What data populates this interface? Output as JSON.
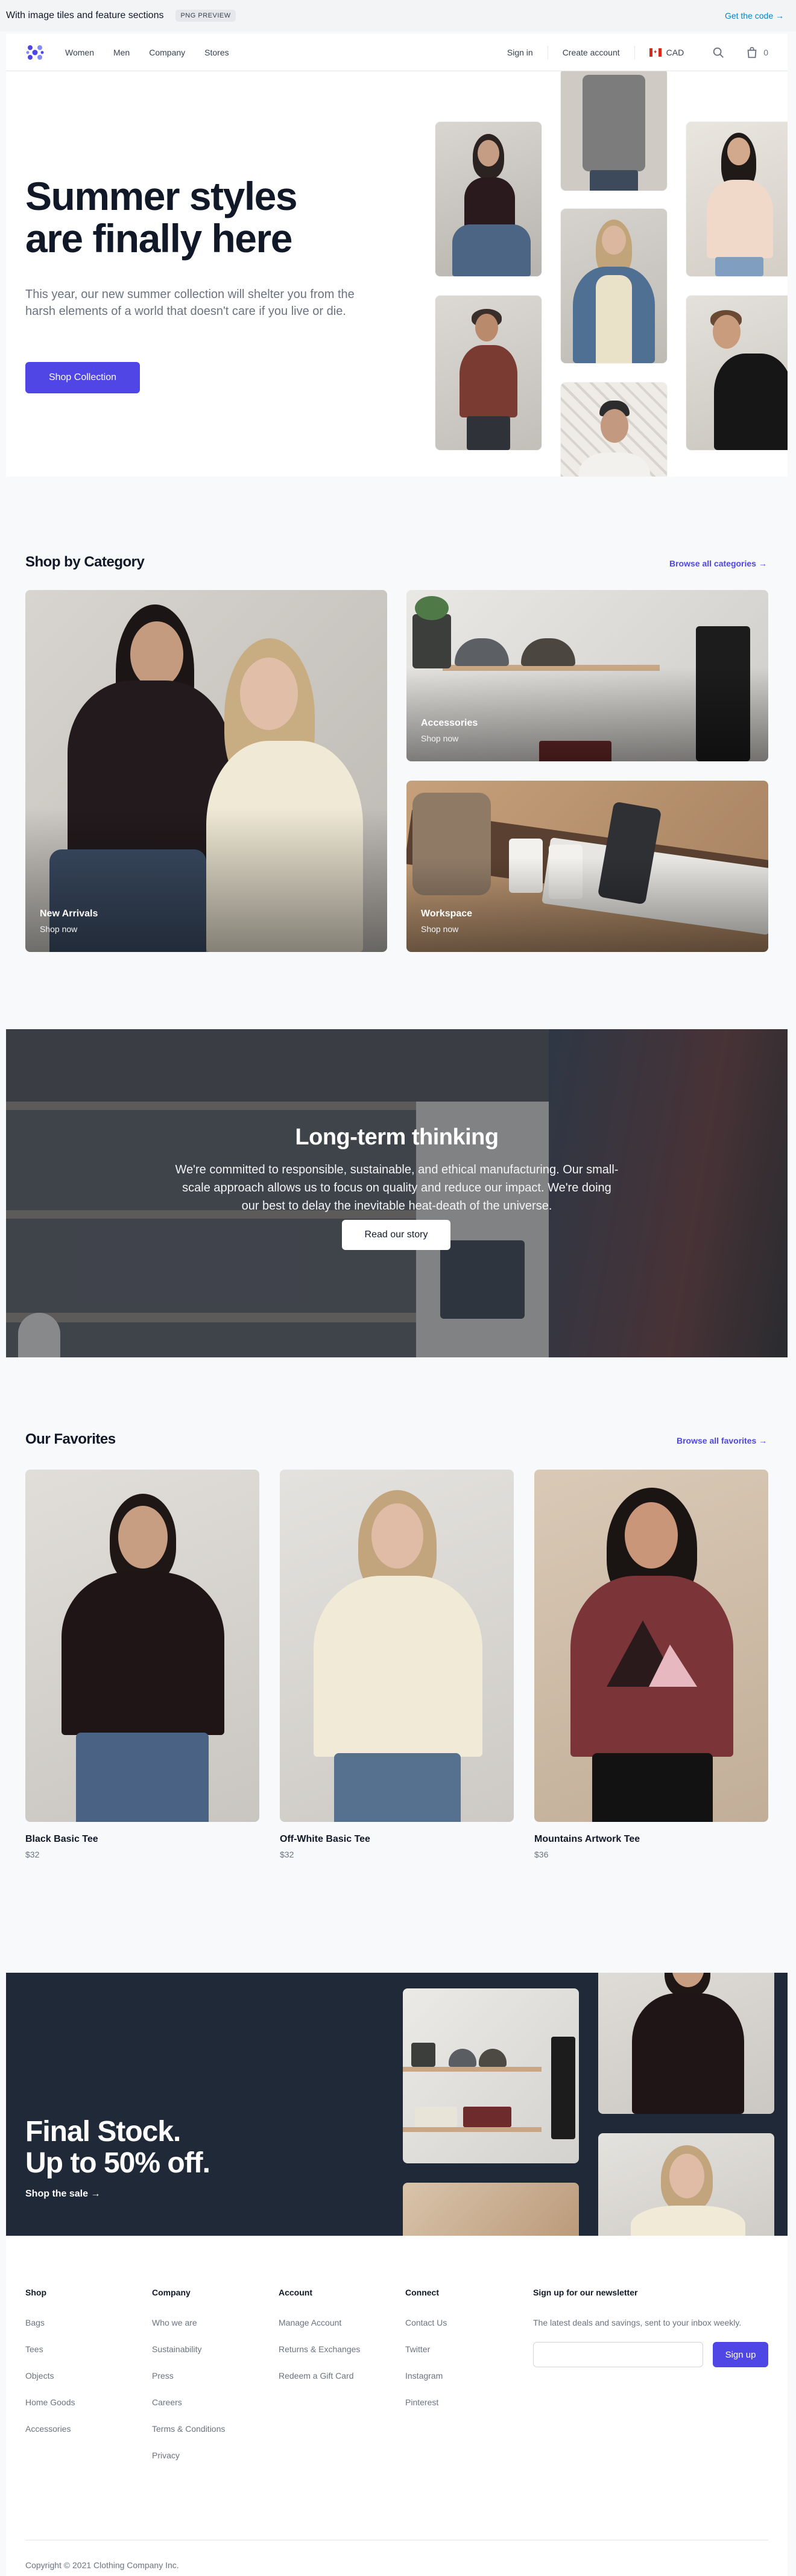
{
  "preview": {
    "title": "With image tiles and feature sections",
    "badge": "PNG PREVIEW",
    "code_link": "Get the code →"
  },
  "nav": {
    "links": [
      "Women",
      "Men",
      "Company",
      "Stores"
    ],
    "sign_in": "Sign in",
    "create_account": "Create account",
    "currency": "CAD",
    "cart_count": "0",
    "logo_icon": "logo-icon",
    "colors": {
      "brand": "#4f46e5"
    }
  },
  "hero": {
    "title": "Summer styles are finally here",
    "description": "This year, our new summer collection will shelter you from the harsh elements of a world that doesn't care if you live or die.",
    "cta": "Shop Collection"
  },
  "category": {
    "title": "Shop by Category",
    "browse_link": "Browse all categories →",
    "cards": [
      {
        "label": "New Arrivals",
        "sub": "Shop now"
      },
      {
        "label": "Accessories",
        "sub": "Shop now"
      },
      {
        "label": "Workspace",
        "sub": "Shop now"
      }
    ]
  },
  "longterm": {
    "title": "Long-term thinking",
    "description": "We're committed to responsible, sustainable, and ethical manufacturing. Our small-scale approach allows us to focus on quality and reduce our impact. We're doing our best to delay the inevitable heat-death of the universe.",
    "cta": "Read our story"
  },
  "favorites": {
    "title": "Our Favorites",
    "browse_link": "Browse all favorites →",
    "items": [
      {
        "name": "Black Basic Tee",
        "price": "$32"
      },
      {
        "name": "Off-White Basic Tee",
        "price": "$32"
      },
      {
        "name": "Mountains Artwork Tee",
        "price": "$36"
      }
    ]
  },
  "sale": {
    "title_line1": "Final Stock.",
    "title_line2": "Up to 50% off.",
    "link": "Shop the sale →"
  },
  "footer": {
    "shop": {
      "title": "Shop",
      "items": [
        "Bags",
        "Tees",
        "Objects",
        "Home Goods",
        "Accessories"
      ]
    },
    "company": {
      "title": "Company",
      "items": [
        "Who we are",
        "Sustainability",
        "Press",
        "Careers",
        "Terms & Conditions",
        "Privacy"
      ]
    },
    "account": {
      "title": "Account",
      "items": [
        "Manage Account",
        "Returns & Exchanges",
        "Redeem a Gift Card"
      ]
    },
    "connect": {
      "title": "Connect",
      "items": [
        "Contact Us",
        "Twitter",
        "Instagram",
        "Pinterest"
      ]
    },
    "newsletter": {
      "title": "Sign up for our newsletter",
      "description": "The latest deals and savings, sent to your inbox weekly.",
      "button": "Sign up"
    },
    "copyright": "Copyright © 2021 Clothing Company Inc."
  }
}
